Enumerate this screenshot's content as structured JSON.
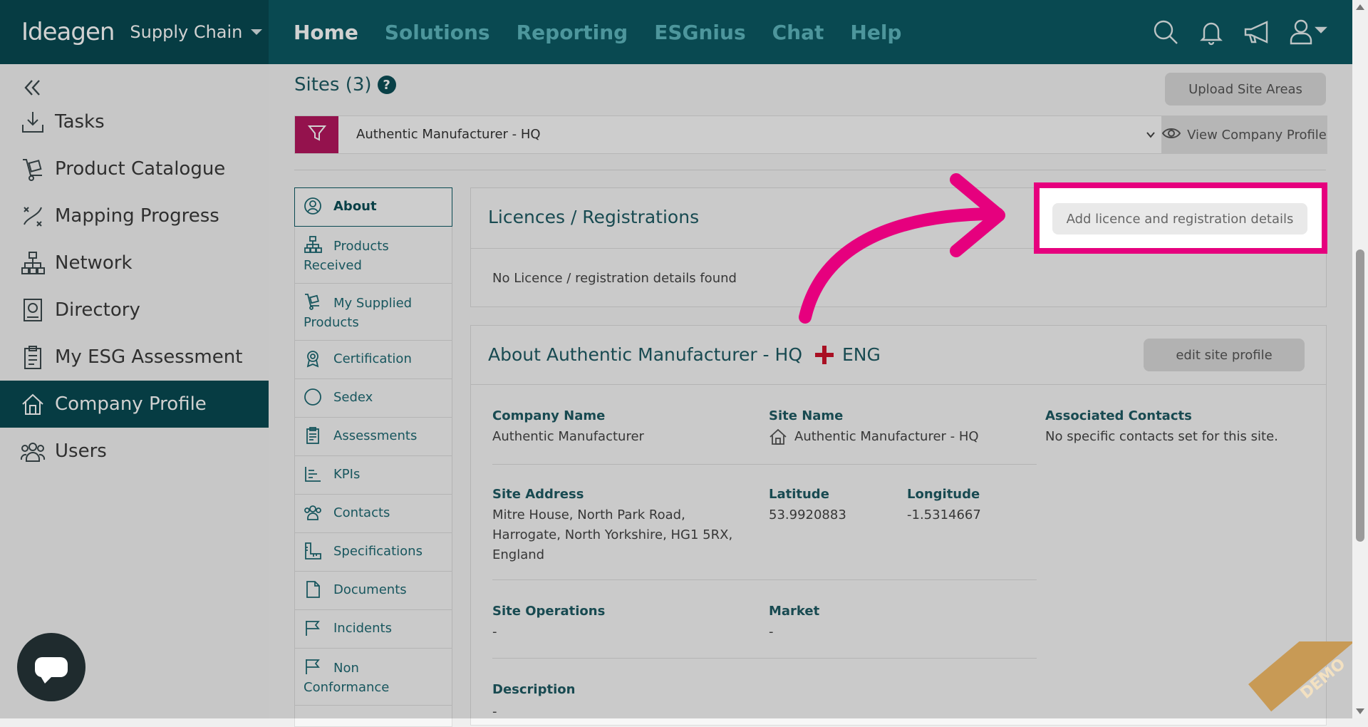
{
  "brand": {
    "logo": "Ideagen",
    "product": "Supply Chain"
  },
  "nav": [
    "Home",
    "Solutions",
    "Reporting",
    "ESGnius",
    "Chat",
    "Help"
  ],
  "sidebar": {
    "items": [
      {
        "label": "Tasks",
        "icon": "download-tray-icon"
      },
      {
        "label": "Product Catalogue",
        "icon": "trolley-icon"
      },
      {
        "label": "Mapping Progress",
        "icon": "route-icon"
      },
      {
        "label": "Network",
        "icon": "network-icon"
      },
      {
        "label": "Directory",
        "icon": "directory-icon"
      },
      {
        "label": "My ESG Assessment",
        "icon": "clipboard-icon"
      },
      {
        "label": "Company Profile",
        "icon": "house-icon",
        "active": true
      },
      {
        "label": "Users",
        "icon": "users-icon"
      }
    ]
  },
  "header": {
    "title": "Sites (3)",
    "help": "?",
    "upload": "Upload Site Areas"
  },
  "filter": {
    "selected": "Authentic Manufacturer - HQ",
    "view_profile": "View Company Profile"
  },
  "tabs": [
    "About",
    "Products Received",
    "My Supplied Products",
    "Certification",
    "Sedex",
    "Assessments",
    "KPIs",
    "Contacts",
    "Specifications",
    "Documents",
    "Incidents",
    "Non Conformance"
  ],
  "licences": {
    "title": "Licences / Registrations",
    "add_button": "Add licence and registration details",
    "empty": "No Licence / registration details found"
  },
  "about": {
    "title": "About Authentic Manufacturer - HQ",
    "country": "ENG",
    "edit": "edit site profile",
    "company_name_label": "Company Name",
    "company_name": "Authentic Manufacturer",
    "site_name_label": "Site Name",
    "site_name": "Authentic Manufacturer - HQ",
    "contacts_label": "Associated Contacts",
    "contacts": "No specific contacts set for this site.",
    "address_label": "Site Address",
    "address_line1": "Mitre House, North Park Road,",
    "address_line2": "Harrogate, North Yorkshire, HG1 5RX,",
    "address_line3": "England",
    "latitude_label": "Latitude",
    "latitude": "53.9920883",
    "longitude_label": "Longitude",
    "longitude": "-1.5314667",
    "operations_label": "Site Operations",
    "operations": "-",
    "market_label": "Market",
    "market": "-",
    "description_label": "Description",
    "description": "-"
  },
  "demo": "DEMO",
  "colors": {
    "brand": "#0b5a63",
    "accent": "#b5175e",
    "highlight": "#e6007e"
  }
}
